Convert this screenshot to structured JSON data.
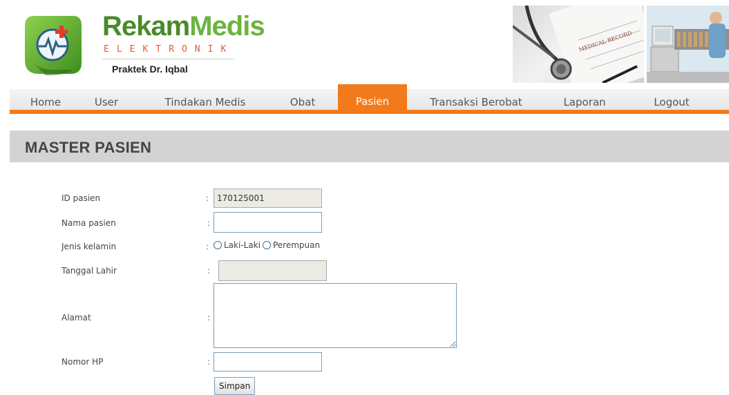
{
  "brand": {
    "title_part1": "Rekam",
    "title_part2": "Medis",
    "subtitle": "ELEKTRONIK",
    "practice": "Praktek Dr. Iqbal"
  },
  "header_images": {
    "medical_record_text": "MEDICAL RECORD"
  },
  "nav": {
    "items": [
      {
        "label": "Home"
      },
      {
        "label": "User"
      },
      {
        "label": "Tindakan Medis"
      },
      {
        "label": "Obat"
      },
      {
        "label": "Pasien"
      },
      {
        "label": "Transaksi Berobat"
      },
      {
        "label": "Laporan"
      },
      {
        "label": "Logout"
      }
    ],
    "active": "Pasien"
  },
  "page": {
    "title": "MASTER PASIEN"
  },
  "form": {
    "separator": ":",
    "id_pasien": {
      "label": "ID pasien",
      "value": "170125001"
    },
    "nama_pasien": {
      "label": "Nama pasien",
      "value": ""
    },
    "jenis_kelamin": {
      "label": "Jenis kelamin",
      "options": [
        "Laki-Laki",
        "Perempuan"
      ],
      "selected": ""
    },
    "tanggal_lahir": {
      "label": "Tanggal Lahir",
      "value": ""
    },
    "alamat": {
      "label": "Alamat",
      "value": ""
    },
    "nomor_hp": {
      "label": "Nomor HP",
      "value": ""
    },
    "submit_label": "Simpan"
  },
  "colors": {
    "accent": "#f27a1a",
    "brand_green": "#6cb33f",
    "title_bar": "#d3d3d3"
  }
}
